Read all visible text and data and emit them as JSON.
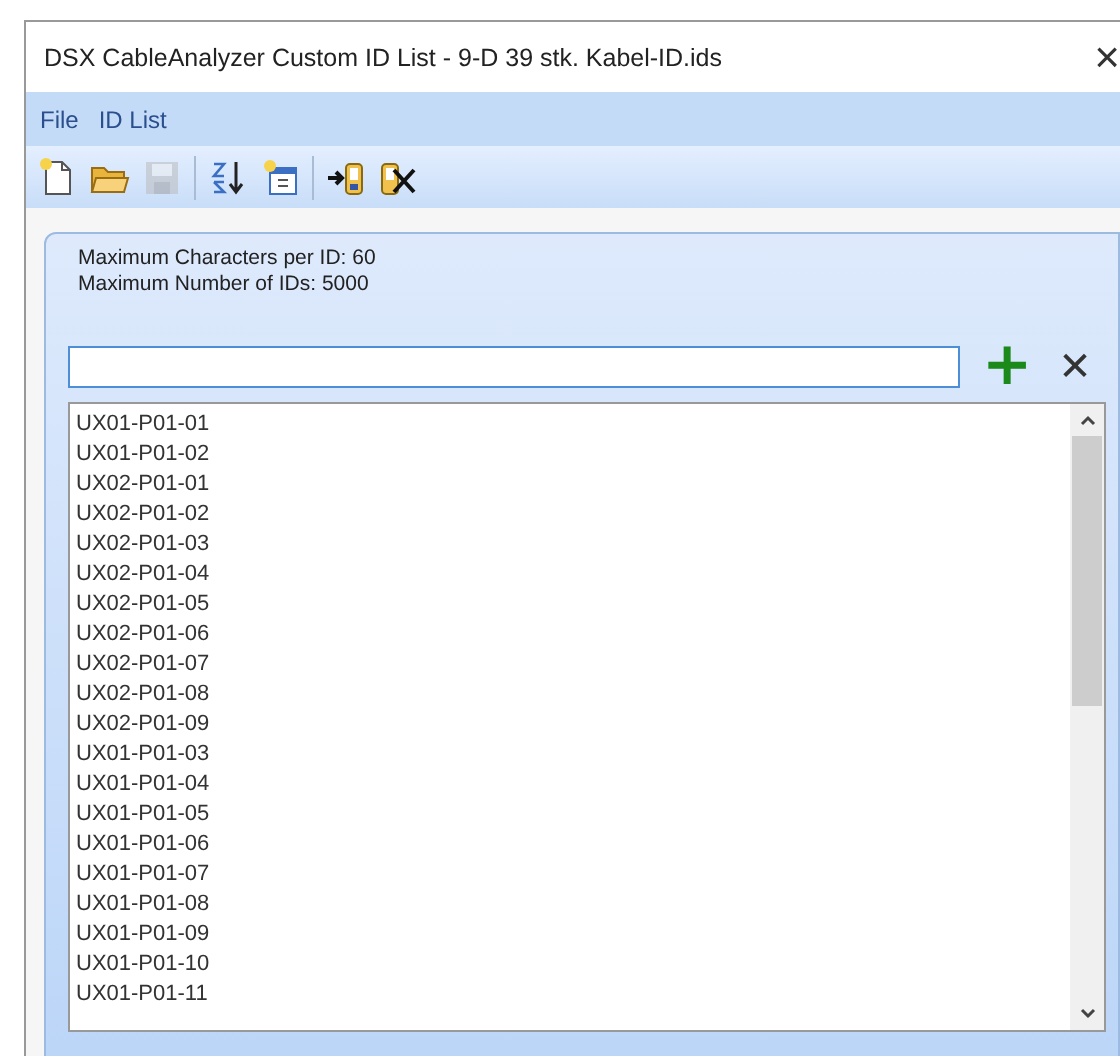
{
  "window": {
    "title": "DSX CableAnalyzer Custom ID List - 9-D 39 stk. Kabel-ID.ids",
    "close": "×"
  },
  "menu": [
    {
      "label": "File"
    },
    {
      "label": "ID List"
    }
  ],
  "toolbar": [
    {
      "kind": "new",
      "disabled": false
    },
    {
      "kind": "open",
      "disabled": false
    },
    {
      "kind": "save",
      "disabled": true
    },
    {
      "kind": "sort",
      "disabled": false
    },
    {
      "kind": "newlist",
      "disabled": false
    },
    {
      "kind": "import",
      "disabled": false
    },
    {
      "kind": "remove",
      "disabled": false
    }
  ],
  "info": [
    "Maximum Characters per ID: 60",
    "Maximum Number of IDs: 5000"
  ],
  "entry": {
    "add": "+",
    "clear": "✕"
  },
  "ids": [
    "UX01-P01-01",
    "UX01-P01-02",
    "UX02-P01-01",
    "UX02-P01-02",
    "UX02-P01-03",
    "UX02-P01-04",
    "UX02-P01-05",
    "UX02-P01-06",
    "UX02-P01-07",
    "UX02-P01-08",
    "UX02-P01-09",
    "UX01-P01-03",
    "UX01-P01-04",
    "UX01-P01-05",
    "UX01-P01-06",
    "UX01-P01-07",
    "UX01-P01-08",
    "UX01-P01-09",
    "UX01-P01-10",
    "UX01-P01-11"
  ]
}
